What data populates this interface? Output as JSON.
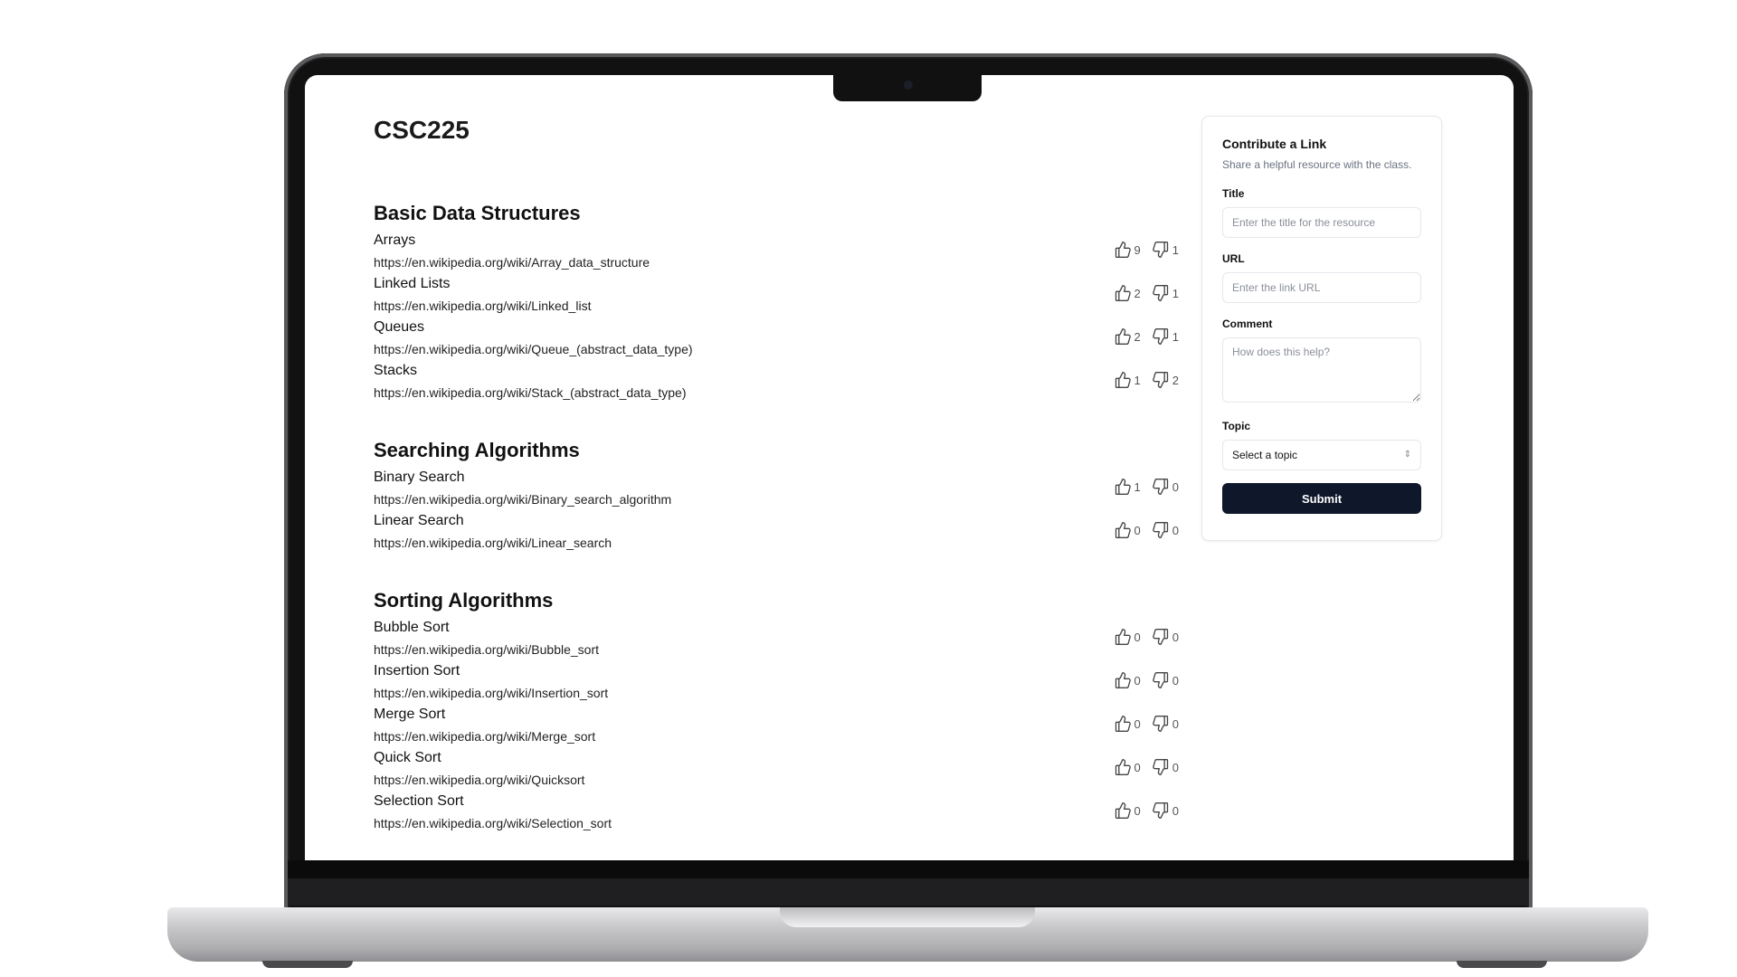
{
  "page": {
    "title": "CSC225"
  },
  "sections": [
    {
      "title": "Basic Data Structures",
      "items": [
        {
          "title": "Arrays",
          "url": "https://en.wikipedia.org/wiki/Array_data_structure",
          "up": "9",
          "down": "1"
        },
        {
          "title": "Linked Lists",
          "url": "https://en.wikipedia.org/wiki/Linked_list",
          "up": "2",
          "down": "1"
        },
        {
          "title": "Queues",
          "url": "https://en.wikipedia.org/wiki/Queue_(abstract_data_type)",
          "up": "2",
          "down": "1"
        },
        {
          "title": "Stacks",
          "url": "https://en.wikipedia.org/wiki/Stack_(abstract_data_type)",
          "up": "1",
          "down": "2"
        }
      ]
    },
    {
      "title": "Searching Algorithms",
      "items": [
        {
          "title": "Binary Search",
          "url": "https://en.wikipedia.org/wiki/Binary_search_algorithm",
          "up": "1",
          "down": "0"
        },
        {
          "title": "Linear Search",
          "url": "https://en.wikipedia.org/wiki/Linear_search",
          "up": "0",
          "down": "0"
        }
      ]
    },
    {
      "title": "Sorting Algorithms",
      "items": [
        {
          "title": "Bubble Sort",
          "url": "https://en.wikipedia.org/wiki/Bubble_sort",
          "up": "0",
          "down": "0"
        },
        {
          "title": "Insertion Sort",
          "url": "https://en.wikipedia.org/wiki/Insertion_sort",
          "up": "0",
          "down": "0"
        },
        {
          "title": "Merge Sort",
          "url": "https://en.wikipedia.org/wiki/Merge_sort",
          "up": "0",
          "down": "0"
        },
        {
          "title": "Quick Sort",
          "url": "https://en.wikipedia.org/wiki/Quicksort",
          "up": "0",
          "down": "0"
        },
        {
          "title": "Selection Sort",
          "url": "https://en.wikipedia.org/wiki/Selection_sort",
          "up": "0",
          "down": "0"
        }
      ]
    }
  ],
  "contribute": {
    "title": "Contribute a Link",
    "subtitle": "Share a helpful resource with the class.",
    "title_label": "Title",
    "title_placeholder": "Enter the title for the resource",
    "url_label": "URL",
    "url_placeholder": "Enter the link URL",
    "comment_label": "Comment",
    "comment_placeholder": "How does this help?",
    "topic_label": "Topic",
    "topic_value": "Select a topic",
    "submit_label": "Submit"
  },
  "icons": {
    "upvote": "thumbs-up-icon",
    "downvote": "thumbs-down-icon",
    "select": "chevron-up-down-icon"
  },
  "colors": {
    "submit_bg": "#0f172a",
    "muted_text": "#6b7280",
    "border": "#e5e7eb"
  }
}
